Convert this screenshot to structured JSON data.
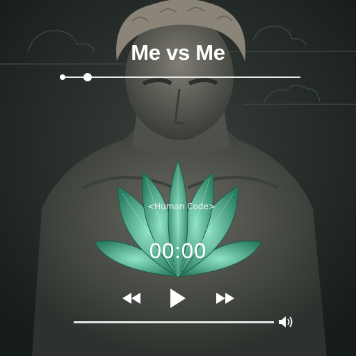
{
  "player": {
    "title": "Me vs Me",
    "artist": "<Human Code>",
    "time": "00:00",
    "progress": 0.11,
    "volume": 1.0
  },
  "controls": {
    "previous": "rewind-icon",
    "play": "play-icon",
    "next": "fast-forward-icon",
    "volume": "speaker-icon"
  },
  "colors": {
    "background": "#1b2220",
    "text": "#ffffff",
    "lotus": "#3fae8a",
    "lotus_light": "#8fe3c6"
  }
}
